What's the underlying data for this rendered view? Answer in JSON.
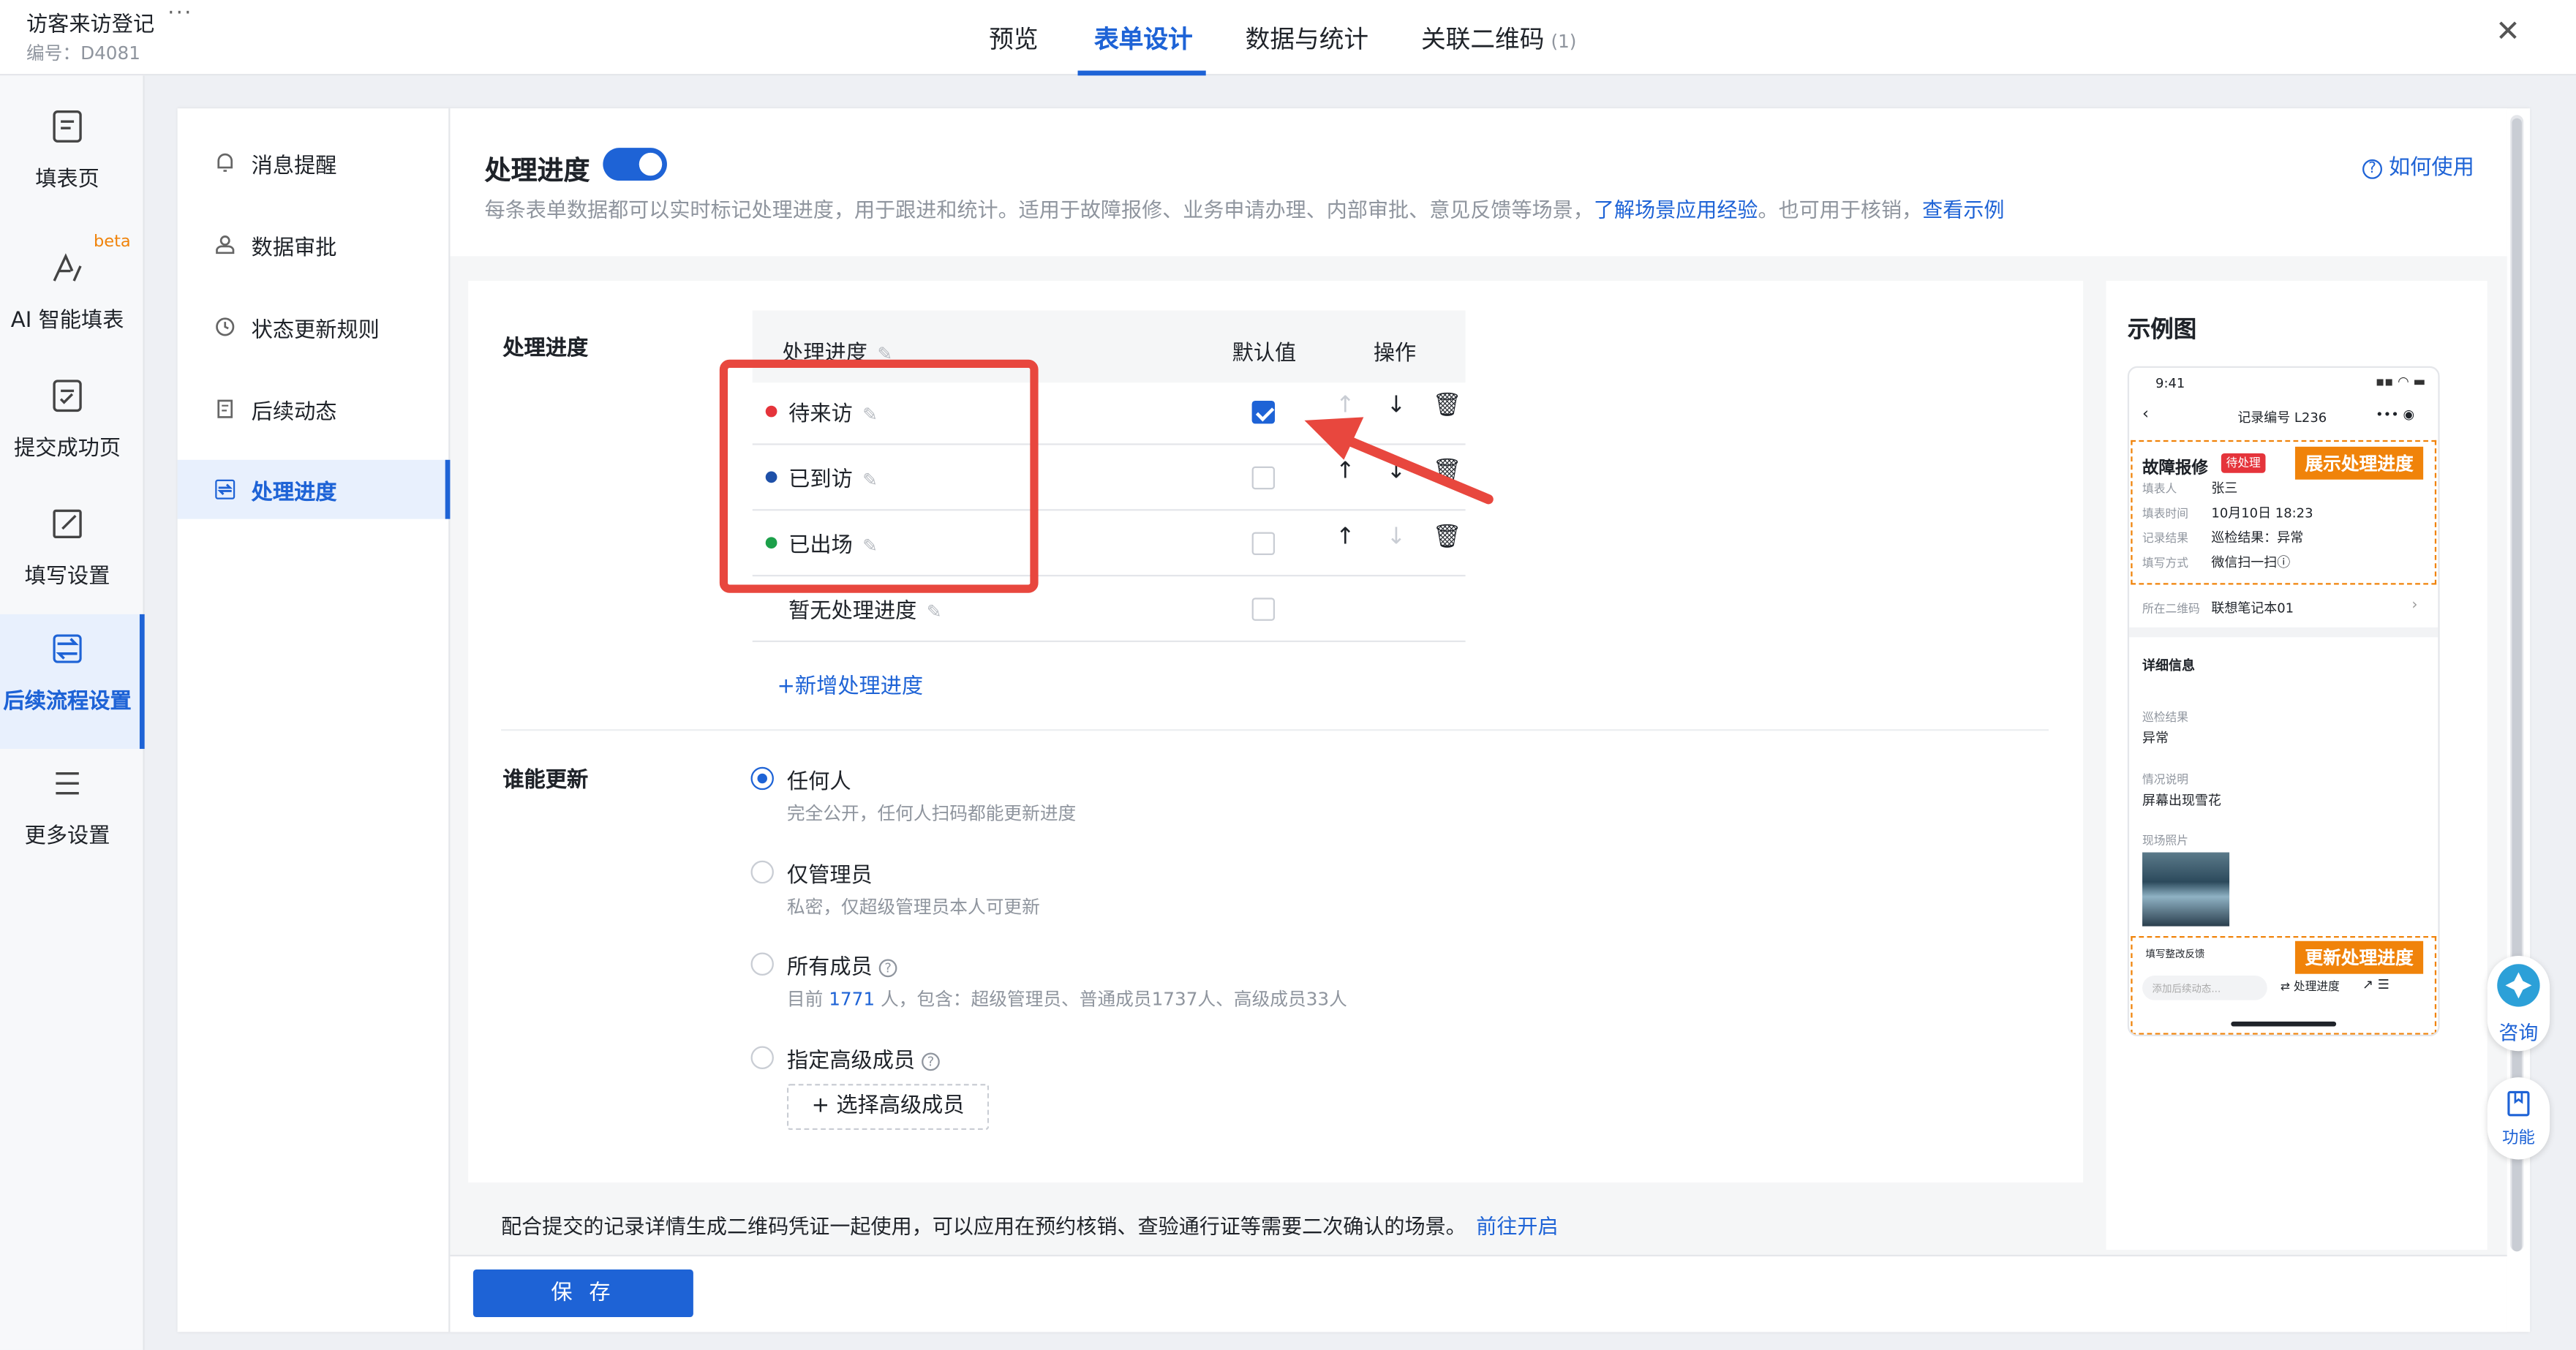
{
  "app": {
    "title": "访客来访登记",
    "more": "···",
    "id": "编号：D4081"
  },
  "tabs": [
    {
      "label": "预览"
    },
    {
      "label": "表单设计"
    },
    {
      "label": "数据与统计"
    },
    {
      "label": "关联二维码",
      "count": "(1)"
    }
  ],
  "rail": [
    {
      "label": "填表页",
      "icon": "form-page-icon"
    },
    {
      "label": "AI 智能填表",
      "icon": "ai-icon",
      "badge": "beta"
    },
    {
      "label": "提交成功页",
      "icon": "success-page-icon"
    },
    {
      "label": "填写设置",
      "icon": "edit-settings-icon"
    },
    {
      "label": "后续流程设置",
      "icon": "flow-icon"
    },
    {
      "label": "更多设置",
      "icon": "menu-icon"
    }
  ],
  "subnav": [
    {
      "label": "消息提醒",
      "icon": "bell-icon"
    },
    {
      "label": "数据审批",
      "icon": "user-icon"
    },
    {
      "label": "状态更新规则",
      "icon": "clock-icon"
    },
    {
      "label": "后续动态",
      "icon": "doc-icon"
    },
    {
      "label": "处理进度",
      "icon": "sync-icon"
    }
  ],
  "header": {
    "title": "处理进度",
    "desc_main": "每条表单数据都可以实时标记处理进度，用于跟进和统计。适用于故障报修、业务申请办理、内部审批、意见反馈等场景，",
    "desc_link1": "了解场景应用经验",
    "desc_mid": "。也可用于核销，",
    "desc_link2": "查看示例",
    "howto": "如何使用"
  },
  "progress": {
    "section_label": "处理进度",
    "col_progress": "处理进度",
    "col_default": "默认值",
    "col_ops": "操作",
    "rows": [
      {
        "label": "待来访",
        "color": "#e5343b",
        "checked": true
      },
      {
        "label": "已到访",
        "color": "#1e50a8",
        "checked": false
      },
      {
        "label": "已出场",
        "color": "#1ca04a",
        "checked": false
      },
      {
        "label": "暂无处理进度",
        "color": "",
        "checked": false
      }
    ],
    "add_label": "+新增处理进度"
  },
  "who": {
    "section_label": "谁能更新",
    "options": [
      {
        "label": "任何人",
        "desc": "完全公开，任何人扫码都能更新进度",
        "selected": true
      },
      {
        "label": "仅管理员",
        "desc": "私密，仅超级管理员本人可更新",
        "selected": false
      },
      {
        "label": "所有成员",
        "desc_pre": "目前 ",
        "desc_num": "1771",
        "desc_post": " 人，包含：超级管理员、普通成员1737人、高级成员33人",
        "selected": false
      },
      {
        "label": "指定高级成员",
        "selected": false
      }
    ],
    "select_btn": "+ 选择高级成员"
  },
  "note": {
    "text": "配合提交的记录详情生成二维码凭证一起使用，可以应用在预约核销、查验通行证等需要二次确认的场景。",
    "link": "前往开启"
  },
  "footer": {
    "save": "保 存"
  },
  "example": {
    "title": "示例图",
    "time": "9:41",
    "record_title": "记录编号 L236",
    "case_title": "故障报修",
    "status_tag": "待处理",
    "show_progress": "展示处理进度",
    "fields": [
      {
        "k": "填表人",
        "v": "张三"
      },
      {
        "k": "填表时间",
        "v": "10月10日 18:23"
      },
      {
        "k": "记录结果",
        "v": "巡检结果：异常"
      },
      {
        "k": "填写方式",
        "v": "微信扫一扫ⓘ"
      }
    ],
    "qr_label": "所在二维码",
    "qr_value": "联想笔记本01",
    "detail_title": "详细信息",
    "d1_k": "巡检结果",
    "d1_v": "异常",
    "d2_k": "情况说明",
    "d2_v": "屏幕出现雪花",
    "d3_k": "现场照片",
    "fix_feedback": "填写整改反馈",
    "update_progress": "更新处理进度",
    "add_dynamic": "添加后续动态...",
    "progress_btn": "⇄ 处理进度"
  },
  "float": {
    "consult": "咨询",
    "func": "功能"
  },
  "close": "✕"
}
